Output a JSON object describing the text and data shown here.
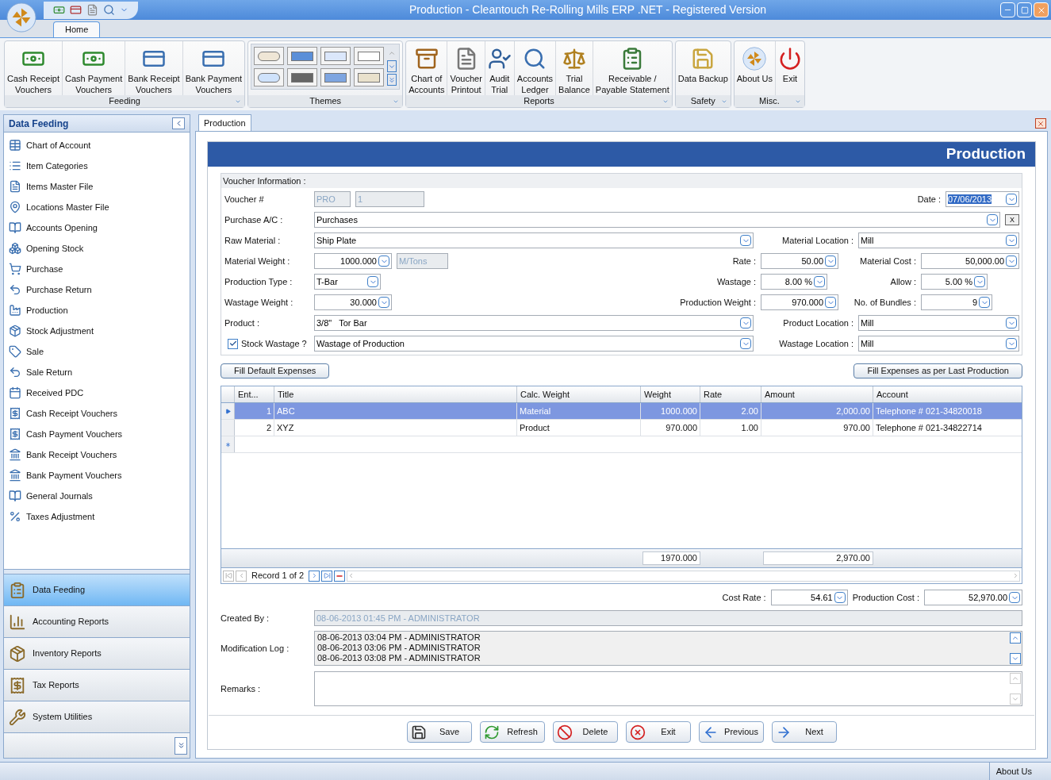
{
  "window": {
    "title": "Production - Cleantouch Re-Rolling Mills ERP .NET - Registered Version"
  },
  "ribbon": {
    "tabs": [
      {
        "label": "Home",
        "selected": true
      }
    ],
    "groups": [
      {
        "title": "Feeding",
        "kind": "buttons",
        "buttons": [
          "Cash Receipt\nVouchers",
          "Cash Payment\nVouchers",
          "Bank Receipt\nVouchers",
          "Bank Payment\nVouchers"
        ]
      },
      {
        "title": "Themes",
        "kind": "gallery"
      },
      {
        "title": "Reports",
        "kind": "buttons",
        "buttons": [
          "Chart of\nAccounts",
          "Voucher\nPrintout",
          "Audit\nTrial",
          "Accounts\nLedger",
          "Trial\nBalance",
          "Receivable /\nPayable Statement"
        ]
      },
      {
        "title": "Safety",
        "kind": "buttons",
        "buttons": [
          "Data Backup"
        ]
      },
      {
        "title": "Misc.",
        "kind": "buttons",
        "buttons": [
          "About Us",
          "Exit"
        ]
      }
    ]
  },
  "sidebar": {
    "title": "Data Feeding",
    "items": [
      "Chart of Account",
      "Item Categories",
      "Items Master File",
      "Locations Master File",
      "Accounts Opening",
      "Opening Stock",
      "Purchase",
      "Purchase Return",
      "Production",
      "Stock Adjustment",
      "Sale",
      "Sale Return",
      "Received PDC",
      "Cash Receipt Vouchers",
      "Cash Payment Vouchers",
      "Bank Receipt Vouchers",
      "Bank Payment Vouchers",
      "General Journals",
      "Taxes Adjustment"
    ],
    "panes": [
      {
        "label": "Data Feeding",
        "selected": true
      },
      {
        "label": "Accounting Reports",
        "selected": false
      },
      {
        "label": "Inventory Reports",
        "selected": false
      },
      {
        "label": "Tax Reports",
        "selected": false
      },
      {
        "label": "System Utilities",
        "selected": false
      }
    ]
  },
  "document_tabs": [
    {
      "label": "Production",
      "selected": true
    }
  ],
  "form": {
    "title": "Production",
    "voucher_info": {
      "title": "Voucher Information :",
      "voucher": {
        "label": "Voucher #",
        "series": "PRO",
        "number": "1",
        "disabled": true
      },
      "date": {
        "label": "Date :",
        "value": "07/06/2013"
      },
      "purchase_ac": {
        "label": "Purchase A/C :",
        "value": "Purchases",
        "clear": "X"
      },
      "raw_material": {
        "label": "Raw Material :",
        "value": "Ship Plate"
      },
      "material_location": {
        "label": "Material Location :",
        "value": "Mill"
      },
      "material_weight": {
        "label": "Material Weight :",
        "value": "1000.000",
        "unit": "M/Tons",
        "unit_disabled": true
      },
      "rate": {
        "label": "Rate :",
        "value": "50.00"
      },
      "material_cost": {
        "label": "Material Cost :",
        "value": "50,000.00"
      },
      "production_type": {
        "label": "Production Type :",
        "value": "T-Bar"
      },
      "wastage": {
        "label": "Wastage :",
        "value": "8.00 %"
      },
      "allow": {
        "label": "Allow :",
        "value": "5.00 %"
      },
      "wastage_weight": {
        "label": "Wastage Weight :",
        "value": "30.000"
      },
      "production_weight": {
        "label": "Production Weight :",
        "value": "970.000"
      },
      "bundles": {
        "label": "No. of Bundles :",
        "value": "9"
      },
      "product": {
        "label": "Product :",
        "value": "3/8\"   Tor Bar"
      },
      "product_location": {
        "label": "Product Location :",
        "value": "Mill"
      },
      "stock_wastage": {
        "label": "Stock Wastage ?",
        "checked": true,
        "value": "Wastage of Production"
      },
      "wastage_location": {
        "label": "Wastage Location :",
        "value": "Mill"
      }
    },
    "fill_buttons": [
      "Fill Default Expenses",
      "Fill Expenses as per Last Production"
    ],
    "grid": {
      "columns": [
        "Ent...",
        "Title",
        "Calc. Weight",
        "Weight",
        "Rate",
        "Amount",
        "Account"
      ],
      "rows": [
        {
          "entry": "1",
          "title": "ABC",
          "calc_weight": "Material",
          "weight": "1000.000",
          "rate": "2.00",
          "amount": "2,000.00",
          "account": "Telephone # 021-34820018",
          "selected": true
        },
        {
          "entry": "2",
          "title": "XYZ",
          "calc_weight": "Product",
          "weight": "970.000",
          "rate": "1.00",
          "amount": "970.00",
          "account": "Telephone # 021-34822714",
          "selected": false
        }
      ],
      "totals": {
        "weight": "1970.000",
        "amount": "2,970.00"
      },
      "navigator": "Record 1 of 2"
    },
    "cost_rate": {
      "label": "Cost Rate :",
      "value": "54.61"
    },
    "production_cost": {
      "label": "Production Cost :",
      "value": "52,970.00"
    },
    "created_by": {
      "label": "Created By :",
      "value": "08-06-2013 01:45 PM - ADMINISTRATOR",
      "disabled": true
    },
    "modification_log": {
      "label": "Modification Log :",
      "lines": [
        "08-06-2013 03:04 PM - ADMINISTRATOR",
        "08-06-2013 03:06 PM - ADMINISTRATOR",
        "08-06-2013 03:08 PM - ADMINISTRATOR"
      ]
    },
    "remarks": {
      "label": "Remarks :"
    },
    "actions": [
      "Save",
      "Refresh",
      "Delete",
      "Exit",
      "Previous",
      "Next"
    ]
  },
  "status_bar": {
    "text": "About Us"
  }
}
